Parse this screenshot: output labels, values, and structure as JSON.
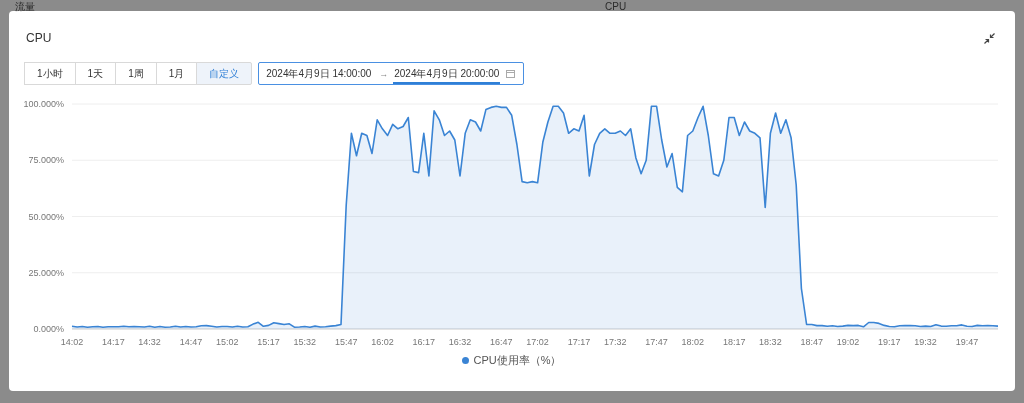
{
  "background": {
    "panel_titles": [
      "流量",
      "CPU"
    ]
  },
  "dialog": {
    "title": "CPU",
    "range_buttons": [
      {
        "label": "1小时",
        "selected": false
      },
      {
        "label": "1天",
        "selected": false
      },
      {
        "label": "1周",
        "selected": false
      },
      {
        "label": "1月",
        "selected": false
      },
      {
        "label": "自定义",
        "selected": true
      }
    ],
    "date_range": {
      "start": {
        "value": "2024年4月9日 14:00:00",
        "active": false
      },
      "separator": "→",
      "end": {
        "value": "2024年4月9日 20:00:00",
        "active": true
      }
    },
    "chart": {
      "chart_data": {
        "type": "area",
        "categories": [
          "14:02",
          null,
          null,
          null,
          null,
          null,
          null,
          null,
          "14:17",
          null,
          null,
          null,
          null,
          null,
          null,
          "14:32",
          null,
          null,
          null,
          null,
          null,
          null,
          null,
          "14:47",
          null,
          null,
          null,
          null,
          null,
          null,
          "15:02",
          null,
          null,
          null,
          null,
          null,
          null,
          null,
          "15:17",
          null,
          null,
          null,
          null,
          null,
          null,
          "15:32",
          null,
          null,
          null,
          null,
          null,
          null,
          null,
          "15:47",
          null,
          null,
          null,
          null,
          null,
          null,
          "16:02",
          null,
          null,
          null,
          null,
          null,
          null,
          null,
          "16:17",
          null,
          null,
          null,
          null,
          null,
          null,
          "16:32",
          null,
          null,
          null,
          null,
          null,
          null,
          null,
          "16:47",
          null,
          null,
          null,
          null,
          null,
          null,
          "17:02",
          null,
          null,
          null,
          null,
          null,
          null,
          null,
          "17:17",
          null,
          null,
          null,
          null,
          null,
          null,
          "17:32",
          null,
          null,
          null,
          null,
          null,
          null,
          null,
          "17:47",
          null,
          null,
          null,
          null,
          null,
          null,
          "18:02",
          null,
          null,
          null,
          null,
          null,
          null,
          null,
          "18:17",
          null,
          null,
          null,
          null,
          null,
          null,
          "18:32",
          null,
          null,
          null,
          null,
          null,
          null,
          null,
          "18:47",
          null,
          null,
          null,
          null,
          null,
          null,
          "19:02",
          null,
          null,
          null,
          null,
          null,
          null,
          null,
          "19:17",
          null,
          null,
          null,
          null,
          null,
          null,
          "19:32",
          null,
          null,
          null,
          null,
          null,
          null,
          null,
          "19:47",
          null,
          null,
          null,
          null,
          null,
          null
        ],
        "series": [
          {
            "name": "CPU使用率（%）",
            "color": "#3a84d4",
            "values": [
              1.2,
              0.9,
              1.1,
              0.8,
              1.0,
              1.1,
              0.8,
              1.0,
              1.0,
              1.0,
              1.2,
              1.0,
              1.1,
              1.0,
              0.9,
              1.2,
              0.8,
              1.1,
              0.8,
              0.9,
              1.2,
              0.9,
              1.1,
              0.9,
              1.0,
              1.4,
              1.5,
              1.2,
              0.9,
              1.1,
              1.1,
              0.9,
              1.2,
              0.9,
              1.0,
              2.2,
              3.0,
              1.2,
              1.6,
              2.8,
              2.4,
              2.0,
              2.3,
              0.8,
              0.9,
              1.1,
              0.8,
              1.3,
              0.9,
              1.0,
              1.3,
              1.5,
              2.0,
              55,
              87,
              77,
              87,
              86,
              78,
              93,
              89,
              86,
              91,
              89,
              90,
              94,
              70,
              69.5,
              87,
              68,
              97,
              93,
              86,
              88,
              84,
              68,
              87,
              93,
              92,
              88,
              97.5,
              98.5,
              99,
              98.5,
              98.5,
              95,
              82,
              65.5,
              65,
              65.5,
              65,
              83,
              92,
              99,
              99,
              96,
              87,
              89,
              88,
              95,
              68,
              82,
              87,
              89,
              87,
              87,
              88,
              86,
              89,
              76,
              69,
              75,
              99,
              99,
              84,
              72,
              78,
              63,
              61,
              86,
              88,
              94,
              99,
              86,
              69,
              68,
              75,
              94,
              94,
              86,
              92,
              88,
              87,
              85,
              54,
              87,
              96,
              87,
              93,
              85,
              64,
              18,
              2,
              2,
              1.5,
              1.5,
              1.2,
              1.4,
              1.1,
              1.3,
              1.6,
              1.5,
              1.6,
              1.0,
              2.9,
              2.9,
              2.5,
              1.6,
              1.1,
              1.0,
              1.4,
              1.5,
              1.5,
              1.4,
              1.1,
              1.3,
              1.1,
              1.9,
              1.3,
              1.2,
              1.4,
              1.4,
              1.8,
              1.2,
              1.1,
              1.6,
              1.4,
              1.5,
              1.4,
              1.3
            ]
          }
        ],
        "ylim": [
          0,
          100
        ],
        "grid": true,
        "yticks": [
          {
            "value": 0,
            "label": "0.000%"
          },
          {
            "value": 25,
            "label": "25.000%"
          },
          {
            "value": 50,
            "label": "50.000%"
          },
          {
            "value": 75,
            "label": "75.000%"
          },
          {
            "value": 100,
            "label": "100.000%"
          }
        ]
      }
    }
  }
}
